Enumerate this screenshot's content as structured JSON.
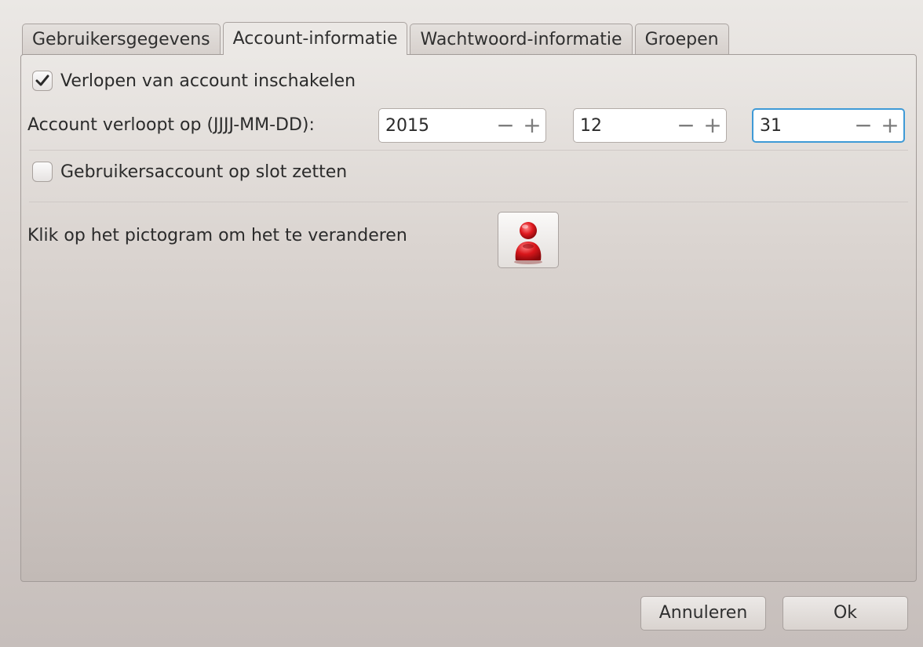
{
  "tabs": [
    {
      "label": "Gebruikersgegevens"
    },
    {
      "label": "Account-informatie"
    },
    {
      "label": "Wachtwoord-informatie"
    },
    {
      "label": "Groepen"
    }
  ],
  "expiry": {
    "enable_label": "Verlopen van account inschakelen",
    "enable_checked": true,
    "date_label": "Account verloopt op (JJJJ-MM-DD):",
    "year": "2015",
    "month": "12",
    "day": "31",
    "minus_glyph": "−",
    "plus_glyph": "+"
  },
  "lock": {
    "label": "Gebruikersaccount op slot zetten",
    "checked": false
  },
  "icon_row": {
    "label": "Klik op het pictogram om het te veranderen",
    "icon": "red-user-icon"
  },
  "footer": {
    "cancel_label": "Annuleren",
    "ok_label": "Ok"
  },
  "colors": {
    "focus_border": "#3f9ad6",
    "user_icon_red": "#d8161b"
  }
}
